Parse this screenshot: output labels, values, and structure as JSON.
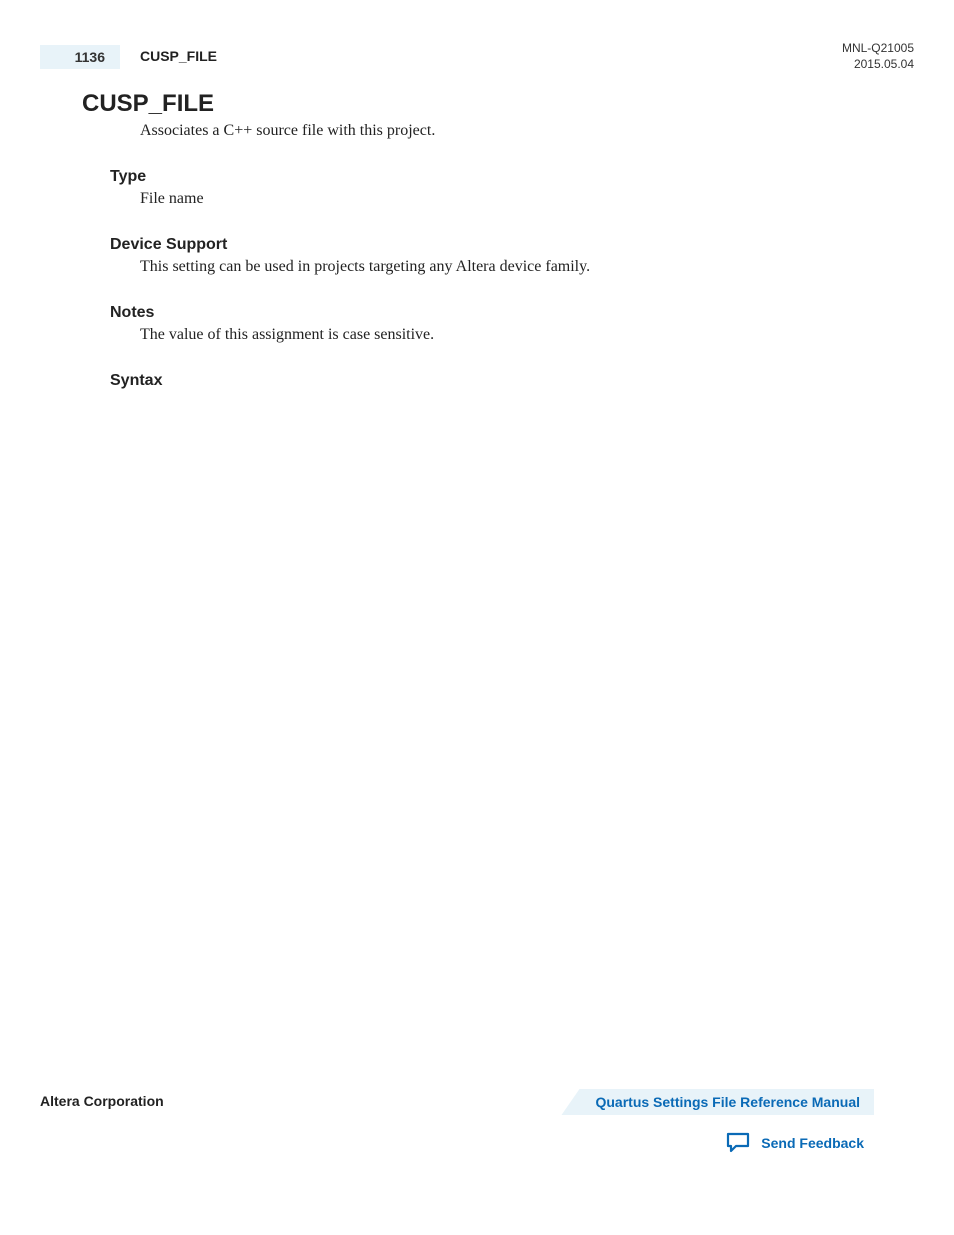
{
  "header": {
    "page_number": "1136",
    "section_title": "CUSP_FILE",
    "doc_id": "MNL-Q21005",
    "doc_date": "2015.05.04"
  },
  "content": {
    "main_heading": "CUSP_FILE",
    "intro": "Associates a C++ source file with this project.",
    "sections": {
      "type": {
        "heading": "Type",
        "body": "File name"
      },
      "device_support": {
        "heading": "Device Support",
        "body": "This setting can be used in projects targeting any Altera device family."
      },
      "notes": {
        "heading": "Notes",
        "body": "The value of this assignment is case sensitive."
      },
      "syntax": {
        "heading": "Syntax"
      }
    }
  },
  "footer": {
    "company": "Altera Corporation",
    "manual_link": "Quartus Settings File Reference Manual",
    "feedback_label": "Send Feedback"
  }
}
